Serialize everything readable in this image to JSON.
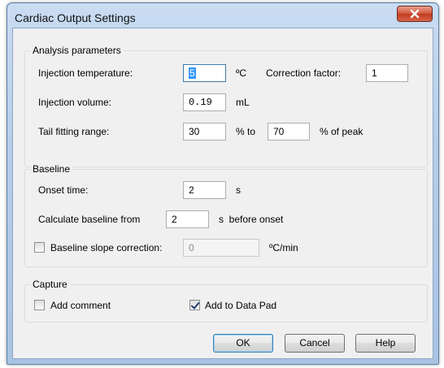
{
  "window": {
    "title": "Cardiac Output Settings",
    "close_icon": "close-icon"
  },
  "analysis": {
    "label": "Analysis parameters",
    "injection_temp": {
      "label": "Injection temperature:",
      "value": "5",
      "unit": "ºC"
    },
    "correction_factor": {
      "label": "Correction factor:",
      "value": "1"
    },
    "injection_volume": {
      "label": "Injection volume:",
      "value": "0.19",
      "unit": "mL"
    },
    "tail_fitting": {
      "label": "Tail fitting range:",
      "from": "30",
      "to_label": "% to",
      "to": "70",
      "suffix": "% of peak"
    }
  },
  "baseline": {
    "label": "Baseline",
    "onset_time": {
      "label": "Onset time:",
      "value": "2",
      "unit": "s"
    },
    "calc_from": {
      "label": "Calculate baseline from",
      "value": "2",
      "suffix": "s  before onset"
    },
    "slope_correction": {
      "label": "Baseline slope correction:",
      "value": "0",
      "unit": "ºC/min",
      "checked": false
    }
  },
  "capture": {
    "label": "Capture",
    "add_comment": {
      "label": "Add comment",
      "checked": false
    },
    "add_to_datapad": {
      "label": "Add to Data Pad",
      "checked": true
    }
  },
  "buttons": {
    "ok": "OK",
    "cancel": "Cancel",
    "help": "Help"
  },
  "colors": {
    "title_bar": "#b9d1ea",
    "close_button": "#c94a30",
    "dialog_bg": "#f0f0f0",
    "selection": "#3399ff"
  }
}
